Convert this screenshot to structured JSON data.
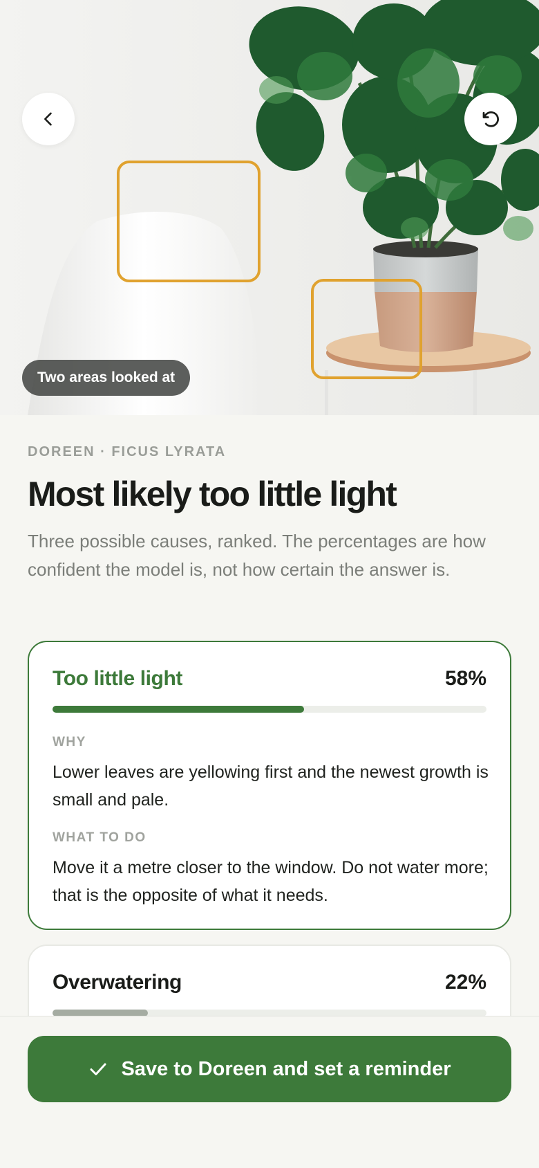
{
  "hero": {
    "areas_label": "Two areas looked at",
    "back_icon": "chevron-left-icon",
    "reset_icon": "rotate-ccw-icon",
    "highlight_color": "#e0a22f"
  },
  "plant": {
    "eyebrow": "DOREEN · FICUS LYRATA",
    "headline": "Most likely too little light",
    "lede": "Three possible causes, ranked. The percentages are how confident the model is, not how certain the answer is."
  },
  "causes": [
    {
      "title": "Too little light",
      "percent_label": "58%",
      "confidence": 0.58,
      "why_label": "WHY",
      "why_text": "Lower leaves are yellowing first and the newest growth is small and pale.",
      "todo_label": "WHAT TO DO",
      "todo_text": "Move it a metre closer to the window. Do not water more; that is the opposite of what it needs."
    },
    {
      "title": "Overwatering",
      "percent_label": "22%",
      "confidence": 0.22
    }
  ],
  "actions": {
    "save_label": "Save to Doreen and set a reminder",
    "save_icon": "check-icon"
  },
  "colors": {
    "accent": "#3d7a3a",
    "background": "#f6f6f2",
    "muted_bar": "#a5aca2"
  }
}
